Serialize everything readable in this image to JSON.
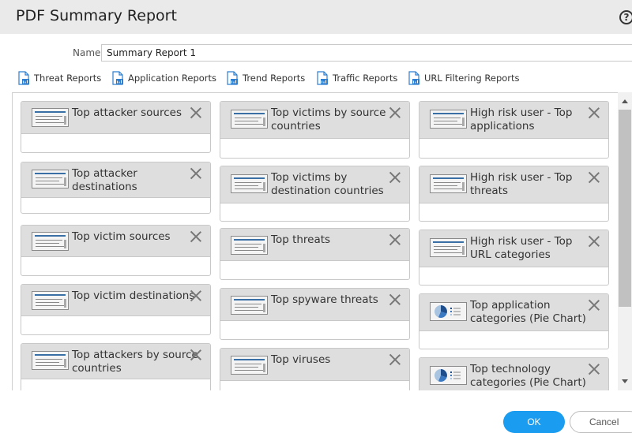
{
  "title": "PDF Summary Report",
  "help_icon": "?",
  "name_field": {
    "label": "Name",
    "value": "Summary Report 1"
  },
  "toolbar": [
    {
      "label": "Threat Reports",
      "icon": "pdf-report-icon"
    },
    {
      "label": "Application Reports",
      "icon": "pdf-report-icon"
    },
    {
      "label": "Trend Reports",
      "icon": "pdf-report-icon"
    },
    {
      "label": "Traffic Reports",
      "icon": "pdf-report-icon"
    },
    {
      "label": "URL Filtering Reports",
      "icon": "pdf-report-icon"
    }
  ],
  "columns": [
    [
      {
        "title": "Top attacker sources",
        "thumb": "table"
      },
      {
        "title": "Top attacker destinations",
        "thumb": "table"
      },
      {
        "title": "Top victim sources",
        "thumb": "table"
      },
      {
        "title": "Top victim destinations",
        "thumb": "table"
      },
      {
        "title": "Top attackers by source countries",
        "thumb": "table"
      }
    ],
    [
      {
        "title": "Top victims by source countries",
        "thumb": "table"
      },
      {
        "title": "Top victims by destination countries",
        "thumb": "table"
      },
      {
        "title": "Top threats",
        "thumb": "table"
      },
      {
        "title": "Top spyware threats",
        "thumb": "table"
      },
      {
        "title": "Top viruses",
        "thumb": "table"
      }
    ],
    [
      {
        "title": "High risk user - Top applications",
        "thumb": "table"
      },
      {
        "title": "High risk user - Top threats",
        "thumb": "table"
      },
      {
        "title": "High risk user - Top URL categories",
        "thumb": "table"
      },
      {
        "title": "Top application categories (Pie Chart)",
        "thumb": "pie"
      },
      {
        "title": "Top technology categories (Pie Chart)",
        "thumb": "pie"
      }
    ]
  ],
  "buttons": {
    "ok": "OK",
    "cancel": "Cancel"
  },
  "colors": {
    "accent": "#1a9cf0",
    "header_bg": "#eaeaea",
    "card_head_bg": "#dedede",
    "pdf_icon": "#2f7fd0"
  }
}
